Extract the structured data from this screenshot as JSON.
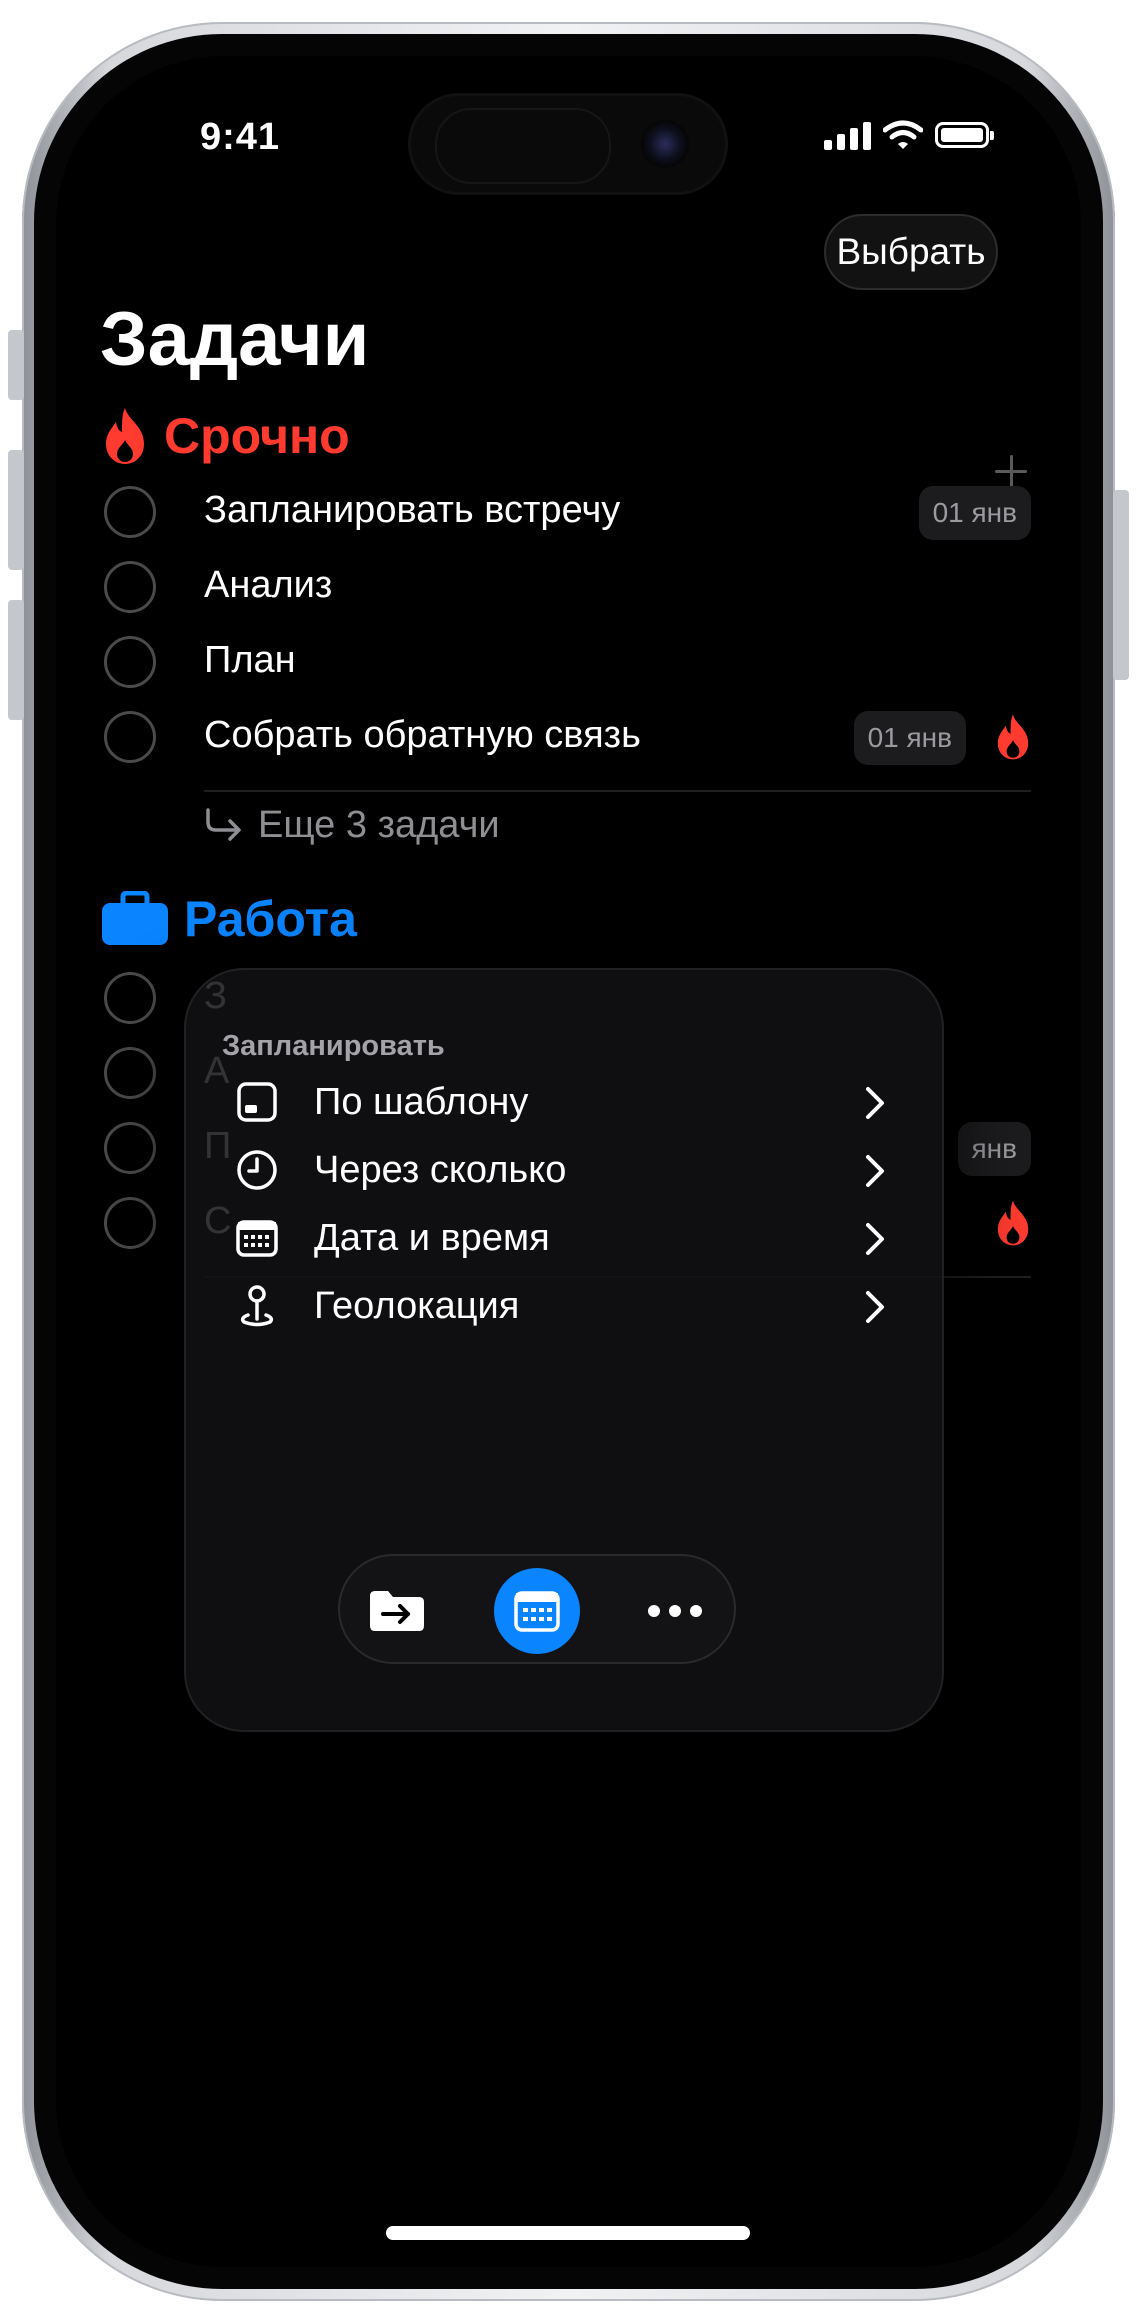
{
  "status_bar": {
    "time": "9:41"
  },
  "header": {
    "select_label": "Выбрать",
    "title": "Задачи"
  },
  "sections": [
    {
      "title": "Срочно",
      "color": "#FF3B30",
      "icon": "flame-icon",
      "tasks": [
        {
          "text": "Запланировать встречу",
          "date": "01 янв",
          "urgent": false
        },
        {
          "text": "Анализ",
          "date": "",
          "urgent": false
        },
        {
          "text": "План",
          "date": "",
          "urgent": false
        },
        {
          "text": "Собрать обратную связь",
          "date": "01 янв",
          "urgent": true
        }
      ],
      "more_label": "Еще 3 задачи"
    },
    {
      "title": "Работа",
      "color": "#0A84FF",
      "icon": "briefcase-icon",
      "tasks": [
        {
          "text": "З",
          "date": "",
          "urgent": false
        },
        {
          "text": "А",
          "date": "",
          "urgent": false
        },
        {
          "text": "П",
          "date": "янв",
          "urgent": false
        },
        {
          "text": "С",
          "date": "",
          "urgent": true
        }
      ]
    }
  ],
  "popover": {
    "title": "Запланировать",
    "items": [
      {
        "label": "По шаблону",
        "icon": "template-icon"
      },
      {
        "label": "Через сколько",
        "icon": "clock-icon"
      },
      {
        "label": "Дата и время",
        "icon": "calendar-grid-icon"
      },
      {
        "label": "Геолокация",
        "icon": "location-pin-icon"
      }
    ]
  },
  "toolbar": {
    "buttons": [
      {
        "icon": "move-to-folder-icon"
      },
      {
        "icon": "calendar-icon",
        "active": true
      },
      {
        "icon": "more-icon"
      }
    ]
  },
  "colors": {
    "accent_red": "#FF3B30",
    "accent_blue": "#0A84FF",
    "background": "#000000"
  }
}
